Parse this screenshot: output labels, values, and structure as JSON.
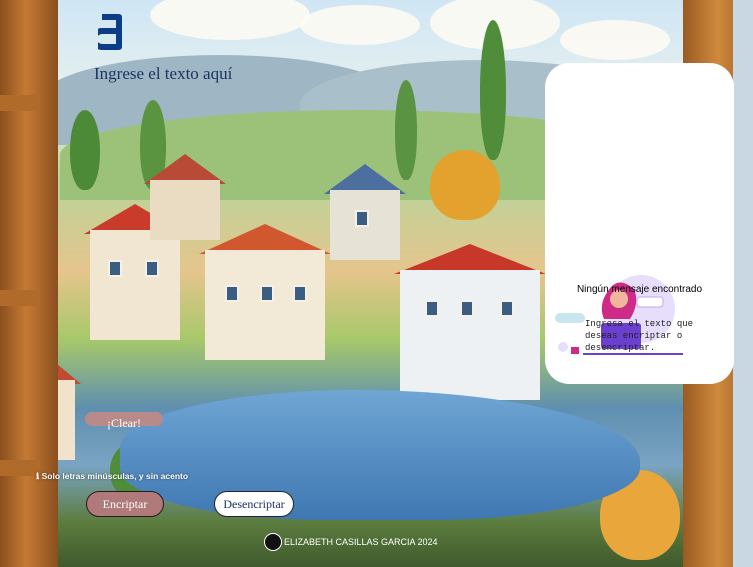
{
  "app": {
    "logo_icon": "alura-logo-icon"
  },
  "input": {
    "placeholder": "Ingrese el texto aquí",
    "value": ""
  },
  "output_panel": {
    "title": "Ningún mensaje encontrado",
    "description": "Ingresa el texto que deseas encriptar o desencriptar.",
    "illustration_icon": "girl-with-laptop-illustration"
  },
  "buttons": {
    "clear_label": "¡Clear!",
    "encrypt_label": "Encriptar",
    "decrypt_label": "Desencriptar"
  },
  "hint": {
    "icon": "info-icon",
    "text": "ℹ Solo letras minúsculas, y sin acento"
  },
  "footer": {
    "icon": "github-icon",
    "text": "ELIZABETH CASILLAS GARCIA 2024"
  },
  "colors": {
    "brand_text": "#1b3560",
    "encrypt_button": "#b07a7a",
    "clear_button": "#b88a8a",
    "panel_bg": "#ffffff"
  }
}
